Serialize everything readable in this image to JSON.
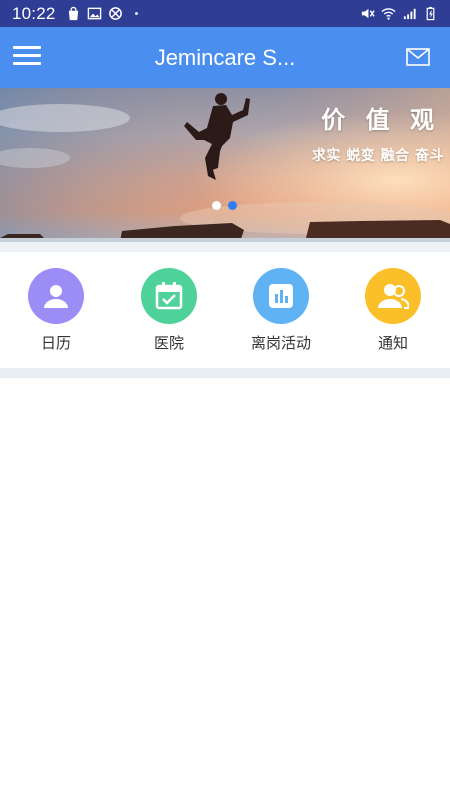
{
  "status_bar": {
    "time": "10:22",
    "left_icons": [
      "shopping-bag-icon",
      "image-icon",
      "blocked-icon",
      "dot-icon"
    ],
    "right_icons": [
      "mute-icon",
      "wifi-icon",
      "signal-icon",
      "battery-icon"
    ]
  },
  "app_bar": {
    "title": "Jemincare S...",
    "menu_icon": "menu-icon",
    "mail_icon": "mail-icon",
    "color": "#4a8ff0"
  },
  "banner": {
    "title": "价 值 观",
    "subtitle": "求实 蜕变 融合 奋斗",
    "dots": [
      false,
      true
    ]
  },
  "grid": {
    "items": [
      {
        "label": "日历",
        "icon": "person-icon",
        "color": "#9b8df5"
      },
      {
        "label": "医院",
        "icon": "calendar-check-icon",
        "color": "#4fd19a"
      },
      {
        "label": "离岗活动",
        "icon": "bar-chart-icon",
        "color": "#5fb3f5"
      },
      {
        "label": "通知",
        "icon": "group-icon",
        "color": "#fbbf2a"
      }
    ]
  },
  "colors": {
    "status_bar": "#2f3d94",
    "accent": "#2f7df6",
    "divider": "#edf1f5"
  }
}
